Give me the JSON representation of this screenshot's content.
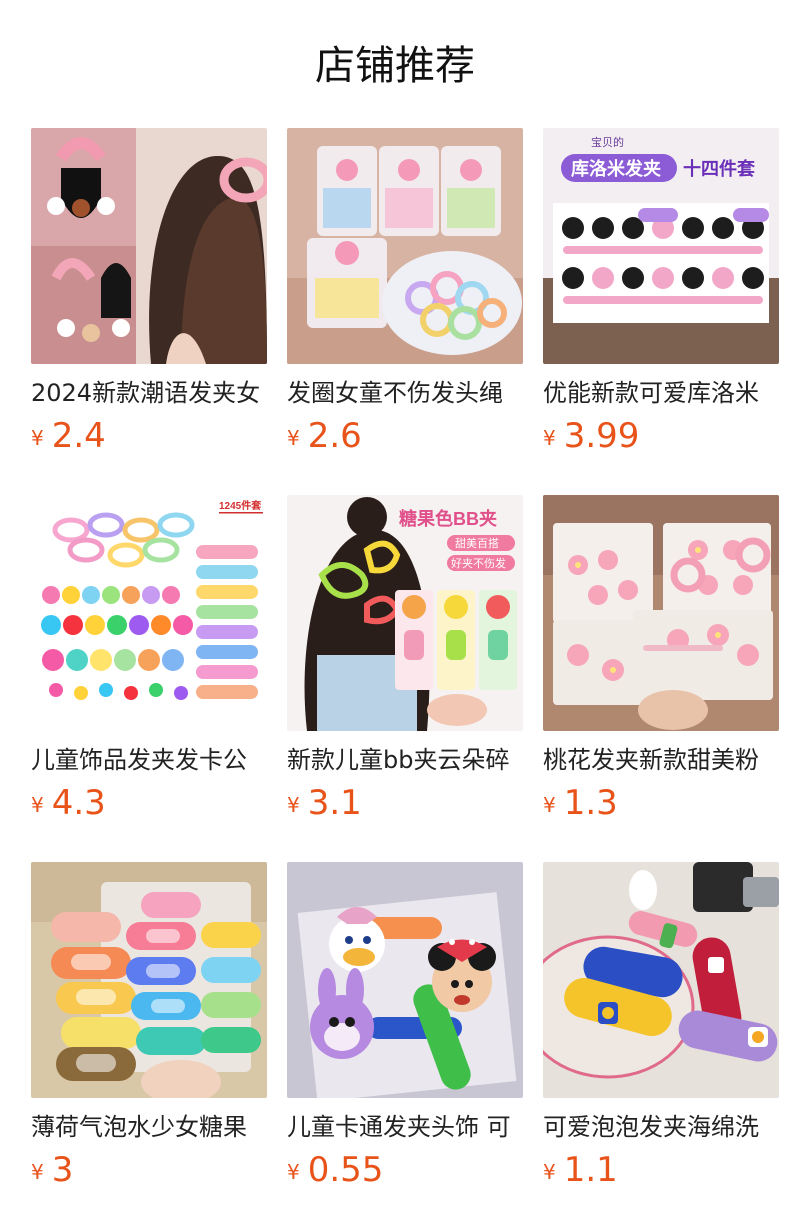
{
  "header": {
    "title": "店铺推荐"
  },
  "products": [
    {
      "name": "2024新款潮语发夹女",
      "currency": "¥",
      "price": "2.4",
      "image_icon": "hair-claw-clip-image"
    },
    {
      "name": "发圈女童不伤发头绳",
      "currency": "¥",
      "price": "2.6",
      "image_icon": "hair-tie-box-image"
    },
    {
      "name": "优能新款可爱库洛米",
      "currency": "¥",
      "price": "3.99",
      "image_icon": "kuromi-clip-set-image",
      "image_text_top": "宝贝的",
      "image_text_main": "库洛米发夹",
      "image_text_badge": "十四件套"
    },
    {
      "name": "儿童饰品发夹发卡公",
      "currency": "¥",
      "price": "4.3",
      "image_icon": "hair-accessory-set-image",
      "image_text_badge": "1245件套"
    },
    {
      "name": "新款儿童bb夹云朵碎",
      "currency": "¥",
      "price": "3.1",
      "image_icon": "candy-color-bb-clip-image",
      "image_text_main": "糖果色BB夹",
      "image_text_tag1": "甜美百搭",
      "image_text_tag2": "好夹不伤发"
    },
    {
      "name": "桃花发夹新款甜美粉",
      "currency": "¥",
      "price": "1.3",
      "image_icon": "peach-blossom-clip-image"
    },
    {
      "name": "薄荷气泡水少女糖果",
      "currency": "¥",
      "price": "3",
      "image_icon": "candy-color-snap-clip-image"
    },
    {
      "name": "儿童卡通发夹头饰 可",
      "currency": "¥",
      "price": "0.55",
      "image_icon": "cartoon-hair-clip-image"
    },
    {
      "name": "可爱泡泡发夹海绵洗",
      "currency": "¥",
      "price": "1.1",
      "image_icon": "sponge-bubble-clip-image"
    }
  ]
}
